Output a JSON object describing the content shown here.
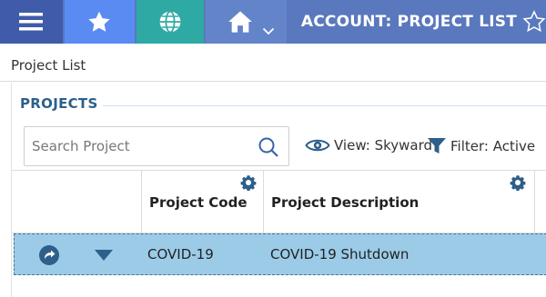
{
  "topbar": {
    "title": "ACCOUNT: PROJECT LIST",
    "icons": [
      "hamburger-menu-icon",
      "star-icon",
      "globe-icon",
      "home-icon",
      "chevron-down-icon",
      "star-outline-icon"
    ],
    "colors": {
      "menu": "#3f5ba9",
      "star": "#5a8bf2",
      "globe": "#2ea9a4",
      "home": "#6384c9",
      "title": "#5a78bd"
    }
  },
  "breadcrumb": {
    "label": "Project List"
  },
  "section": {
    "title": "PROJECTS"
  },
  "search": {
    "placeholder": "Search Project"
  },
  "view": {
    "label": "View: Skyward"
  },
  "filter": {
    "label": "Filter: Active"
  },
  "grid": {
    "columns": [
      "Project Code",
      "Project Description"
    ],
    "rows": [
      {
        "code": "COVID-19",
        "description": "COVID-19 Shutdown"
      }
    ],
    "row_highlight_color": "#9ccbe8"
  }
}
